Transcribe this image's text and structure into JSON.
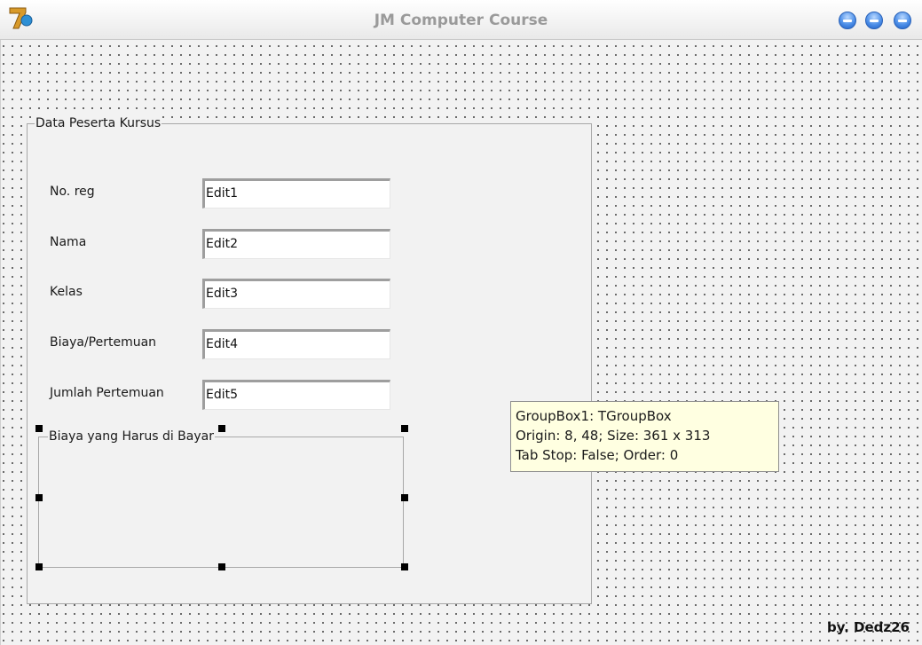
{
  "window": {
    "title": "JM Computer Course",
    "icon": "delphi-7-icon",
    "buttons": [
      "minimize-button",
      "maximize-button",
      "close-button"
    ],
    "accent_color": "#3a7bd5"
  },
  "groupbox_main": {
    "caption": "Data Peserta Kursus",
    "fields": [
      {
        "label": "No. reg",
        "value": "Edit1"
      },
      {
        "label": "Nama",
        "value": "Edit2"
      },
      {
        "label": "Kelas",
        "value": "Edit3"
      },
      {
        "label": "Biaya/Pertemuan",
        "value": "Edit4"
      },
      {
        "label": "Jumlah Pertemuan",
        "value": "Edit5"
      }
    ]
  },
  "groupbox_payment": {
    "caption": "Biaya yang Harus di Bayar"
  },
  "tooltip": {
    "line1": "GroupBox1: TGroupBox",
    "line2": "Origin: 8, 48; Size: 361 x 313",
    "line3": "Tab Stop: False; Order: 0"
  },
  "credit": "by. Dedz26"
}
